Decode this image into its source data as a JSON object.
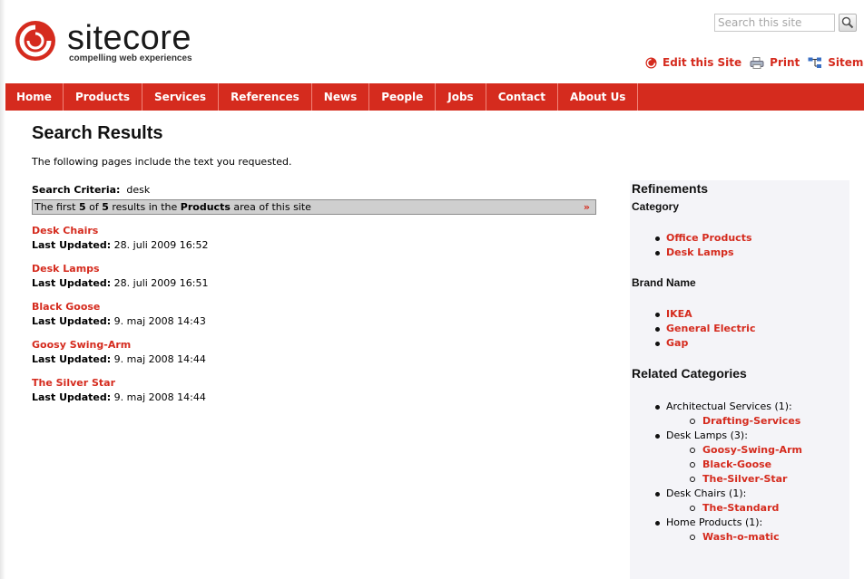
{
  "brand": {
    "name": "sitecore",
    "tagline": "compelling web experiences"
  },
  "search": {
    "placeholder": "Search this site"
  },
  "tools": [
    {
      "label": "Edit this Site",
      "icon": "edit-icon"
    },
    {
      "label": "Print",
      "icon": "print-icon"
    },
    {
      "label": "Sitemap",
      "icon": "sitemap-icon"
    }
  ],
  "nav": [
    "Home",
    "Products",
    "Services",
    "References",
    "News",
    "People",
    "Jobs",
    "Contact",
    "About Us"
  ],
  "main": {
    "title": "Search Results",
    "intro": "The following pages include the text you requested.",
    "criteria_label": "Search Criteria:",
    "criteria_value": "desk",
    "summary": {
      "pre": "The first ",
      "shown": "5",
      "of": " of ",
      "total": "5",
      "mid": " results in the ",
      "area": "Products",
      "post": " area of this site",
      "more": "»"
    },
    "updated_label": "Last Updated:",
    "results": [
      {
        "title": "Desk Chairs",
        "updated": "28. juli 2009 16:52"
      },
      {
        "title": "Desk Lamps",
        "updated": "28. juli 2009 16:51"
      },
      {
        "title": "Black Goose",
        "updated": "9. maj 2008 14:43"
      },
      {
        "title": "Goosy Swing-Arm",
        "updated": "9. maj 2008 14:44"
      },
      {
        "title": "The Silver Star",
        "updated": "9. maj 2008 14:44"
      }
    ]
  },
  "sidebar": {
    "refinements_title": "Refinements",
    "category_label": "Category",
    "categories": [
      "Office Products",
      "Desk Lamps"
    ],
    "brand_label": "Brand Name",
    "brands": [
      "IKEA",
      "General Electric",
      "Gap"
    ],
    "related_title": "Related Categories",
    "related": [
      {
        "name": "Architectual Services (1):",
        "items": [
          "Drafting-Services"
        ]
      },
      {
        "name": "Desk Lamps (3):",
        "items": [
          "Goosy-Swing-Arm",
          "Black-Goose",
          "The-Silver-Star"
        ]
      },
      {
        "name": "Desk Chairs (1):",
        "items": [
          "The-Standard"
        ]
      },
      {
        "name": "Home Products (1):",
        "items": [
          "Wash-o-matic"
        ]
      }
    ]
  },
  "colors": {
    "accent": "#d52b1e",
    "sidebar_bg": "#f4f4f8"
  }
}
